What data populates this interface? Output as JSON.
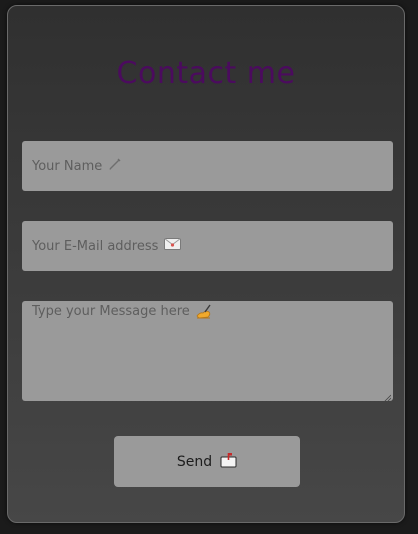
{
  "form": {
    "title": "Contact me",
    "name_placeholder": "Your Name 🖊",
    "name_text": "Your Name",
    "email_text": "Your E-Mail address",
    "message_text": "Type your Message here",
    "send_label": "Send",
    "icons": {
      "name": "pen-icon",
      "email": "envelope-icon",
      "message": "writing-hand-icon",
      "send": "mailbox-icon"
    },
    "colors": {
      "title": "#4b0b5e",
      "field_background": "#9a9a9a",
      "card_background": "#3a3a3a"
    }
  }
}
